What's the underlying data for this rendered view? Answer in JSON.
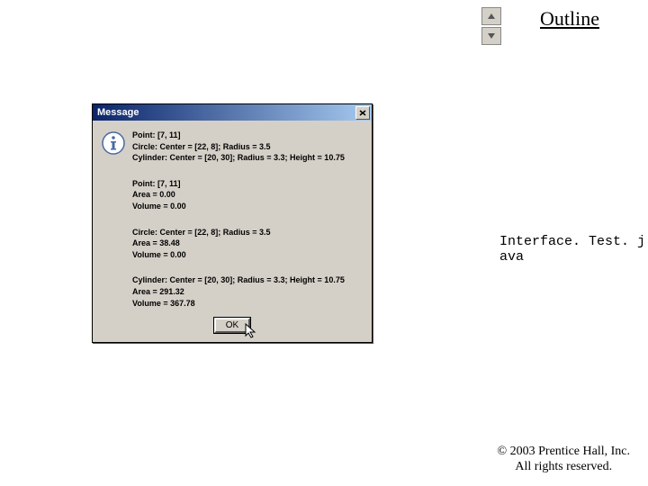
{
  "nav": {
    "up_icon": "arrow-up-icon",
    "down_icon": "arrow-down-icon"
  },
  "outline": {
    "label": "Outline"
  },
  "dialog": {
    "title": "Message",
    "blocks": [
      {
        "lines": [
          "Point: [7, 11]",
          "Circle: Center = [22, 8]; Radius = 3.5",
          "Cylinder: Center = [20, 30]; Radius = 3.3; Height = 10.75"
        ]
      },
      {
        "lines": [
          "Point: [7, 11]",
          "Area = 0.00",
          "Volume = 0.00"
        ]
      },
      {
        "lines": [
          "Circle: Center = [22, 8]; Radius = 3.5",
          "Area = 38.48",
          "Volume = 0.00"
        ]
      },
      {
        "lines": [
          "Cylinder: Center = [20, 30]; Radius = 3.3; Height = 10.75",
          "Area = 291.32",
          "Volume = 367.78"
        ]
      }
    ],
    "ok_label": "OK"
  },
  "side": {
    "text": "Interface. Test. j\nava"
  },
  "footer": {
    "line1": "© 2003 Prentice Hall, Inc.",
    "line2": "All rights reserved."
  }
}
